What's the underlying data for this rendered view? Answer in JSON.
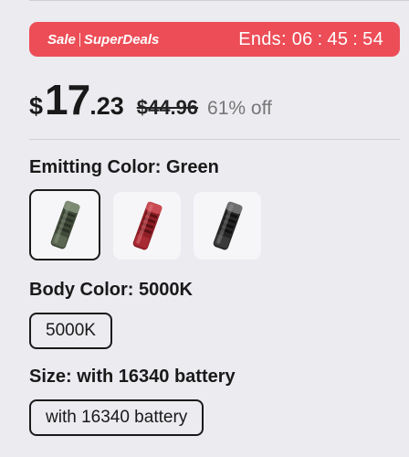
{
  "sale": {
    "brand_left": "Sale",
    "brand_right": "SuperDeals",
    "ends_label": "Ends:",
    "hours": "06",
    "minutes": "45",
    "seconds": "54",
    "color": "#ec4d57"
  },
  "price": {
    "currency": "$",
    "integer": "17",
    "decimal": ".23",
    "original": "$44.96",
    "discount": "61% off"
  },
  "emitting_color": {
    "label": "Emitting Color: Green",
    "options": [
      {
        "name": "green",
        "icon": "flashlight-green-icon",
        "selected": true
      },
      {
        "name": "red",
        "icon": "flashlight-red-icon",
        "selected": false
      },
      {
        "name": "black",
        "icon": "flashlight-black-icon",
        "selected": false
      }
    ]
  },
  "body_color": {
    "label": "Body Color: 5000K",
    "option": "5000K"
  },
  "size": {
    "label": "Size: with 16340 battery",
    "option": "with 16340 battery"
  }
}
